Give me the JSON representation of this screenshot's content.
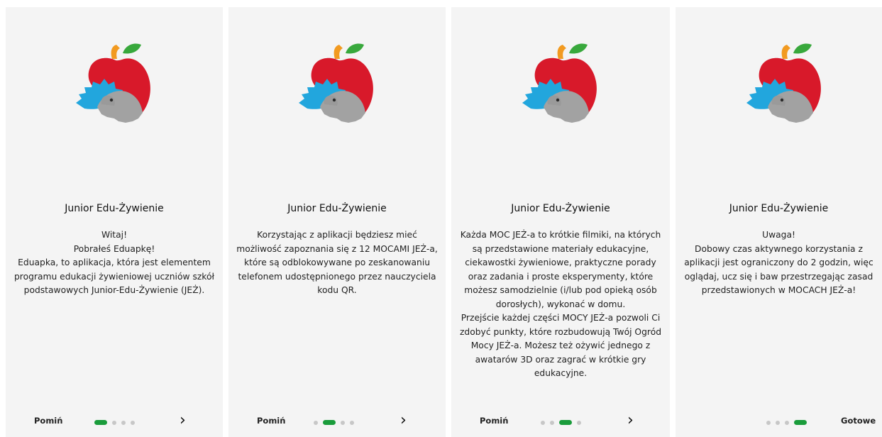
{
  "app_title": "Junior Edu-Żywienie",
  "logo_icon": "apple-hedgehog-logo-icon",
  "colors": {
    "apple_red": "#d8192a",
    "leaf_green": "#38a83c",
    "stem_orange": "#f29a20",
    "hedgehog_blue": "#22a6dd",
    "hedgehog_grey": "#9d9d9d",
    "active_dot": "#1a9c3b"
  },
  "screens": [
    {
      "title": "Junior Edu-Żywienie",
      "body": "Witaj!\nPobrałeś Eduapkę!\nEduapka, to aplikacja, która jest elementem\nprogramu edukacji żywieniowej uczniów szkół\npodstawowych Junior-Edu-Żywienie (JEŻ).",
      "skip_label": "Pomiń",
      "next_icon": "chevron-right-icon",
      "next_glyph": "›"
    },
    {
      "title": "Junior Edu-Żywienie",
      "body": "Korzystając z aplikacji będziesz mieć\nmożliwość zapoznania się z 12 MOCAMI JEŻ-a,\nktóre są odblokowywane po zeskanowaniu\ntelefonem udostępnionego przez nauczyciela\nkodu QR.",
      "skip_label": "Pomiń",
      "next_icon": "chevron-right-icon",
      "next_glyph": "›"
    },
    {
      "title": "Junior Edu-Żywienie",
      "body": "Każda MOC JEŻ-a to krótkie filmiki, na których\nsą przedstawione materiały edukacyjne,\nciekawostki żywieniowe, praktyczne porady\noraz zadania i proste eksperymenty, które\nmożesz samodzielnie (i/lub pod opieką osób\ndorosłych), wykonać w domu.\nPrzejście każdej części MOCY JEŻ-a pozwoli Ci\nzdobyć punkty, które rozbudowują Twój Ogród\nMocy JEŻ-a. Możesz też ożywić jednego z\nawatarów 3D oraz zagrać w krótkie gry\nedukacyjne.",
      "skip_label": "Pomiń",
      "next_icon": "chevron-right-icon",
      "next_glyph": "›"
    },
    {
      "title": "Junior Edu-Żywienie",
      "body": "Uwaga!\nDobowy czas aktywnego korzystania z\naplikacji jest ograniczony do 2 godzin, więc\noglądaj, ucz się i baw przestrzegając zasad\nprzedstawionych w MOCACH JEŻ-a!",
      "done_label": "Gotowe"
    }
  ],
  "pagination": {
    "total": 4,
    "active_per_screen": [
      1,
      2,
      3,
      4
    ]
  }
}
